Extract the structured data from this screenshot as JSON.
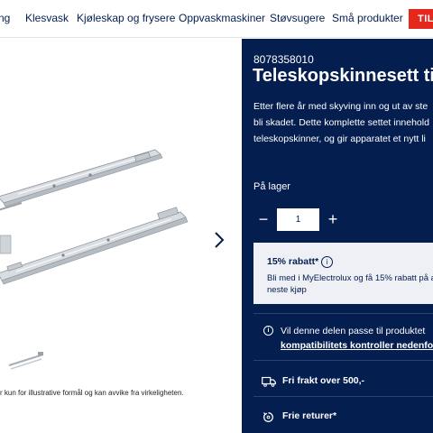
{
  "nav": {
    "items": [
      "ng",
      "Klesvask",
      "Kjøleskap og frysere",
      "Oppvaskmaskiner",
      "Støvsugere",
      "Små produkter"
    ],
    "cta_label": "TILB"
  },
  "gallery": {
    "next_icon": "chevron-right-icon",
    "disclaimer": "r kun for illustrative formål og kan avvike fra virkeligheten."
  },
  "product": {
    "sku": "8078358010",
    "title": "Teleskopskinnesett ti",
    "description_lines": [
      "Etter flere år med skyving inn og ut av ste",
      "bli skadet. Dette komplette settet innehold",
      "teleskopskinner, og gir apparatet et nytt li"
    ],
    "stock_status": "På lager",
    "quantity": "1",
    "qty_minus_icon": "minus-icon",
    "qty_plus_icon": "plus-icon"
  },
  "discount": {
    "title": "15% rabatt*",
    "info_icon": "info-icon",
    "text_lines": [
      "Bli med i MyElectrolux og få 15% rabatt på a",
      "neste kjøp"
    ]
  },
  "compatibility": {
    "icon": "info-icon",
    "text": "Vil denne delen passe til produktet",
    "link": "kompatibilitets kontroller nedenfor"
  },
  "shipping": {
    "icon": "truck-icon",
    "text": "Fri frakt over 500,-"
  },
  "returns": {
    "icon": "return-icon",
    "text": "Frie returer*"
  },
  "colors": {
    "brand_navy": "#041e50",
    "cta_red": "#e4281e",
    "discount_bg": "#eef0f5"
  }
}
